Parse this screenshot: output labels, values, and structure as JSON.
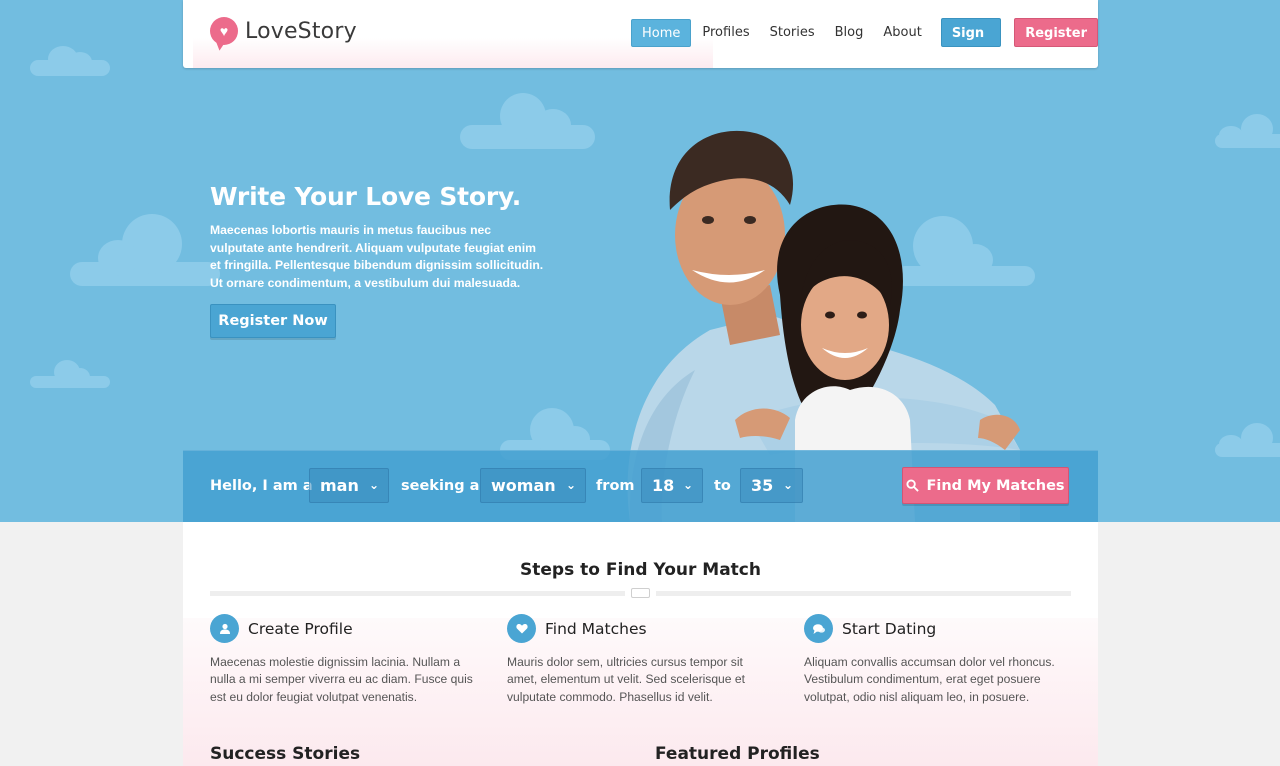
{
  "brand": {
    "name": "LoveStory"
  },
  "nav": {
    "items": [
      {
        "label": "Home",
        "active": true
      },
      {
        "label": "Profiles",
        "active": false
      },
      {
        "label": "Stories",
        "active": false
      },
      {
        "label": "Blog",
        "active": false
      },
      {
        "label": "About",
        "active": false
      }
    ],
    "sign_in": "Sign In",
    "register": "Register"
  },
  "hero": {
    "title": "Write Your Love Story.",
    "description": "Maecenas lobortis mauris in metus faucibus nec vulputate ante hendrerit. Aliquam vulputate feugiat enim et fringilla. Pellentesque bibendum dignissim sollicitudin. Ut ornare condimentum, a vestibulum dui malesuada.",
    "cta": "Register Now"
  },
  "search": {
    "hello_label": "Hello, I am a",
    "gender_value": "man",
    "seeking_label": "seeking a",
    "seeking_value": "woman",
    "from_label": "from",
    "age_from": "18",
    "to_label": "to",
    "age_to": "35",
    "submit": "Find My Matches"
  },
  "steps": {
    "title": "Steps to Find Your Match",
    "items": [
      {
        "icon": "user-icon",
        "title": "Create Profile",
        "text": "Maecenas molestie dignissim lacinia. Nullam a nulla a mi semper viverra eu ac diam. Fusce quis est eu dolor feugiat volutpat venenatis."
      },
      {
        "icon": "heart-icon",
        "title": "Find Matches",
        "text": "Mauris dolor sem, ultricies cursus tempor sit amet, elementum ut velit. Sed scelerisque et vulputate commodo. Phasellus id velit."
      },
      {
        "icon": "chat-icon",
        "title": "Start Dating",
        "text": "Aliquam convallis accumsan dolor vel rhoncus. Vestibulum condimentum, erat eget posuere volutpat, odio nisl aliquam leo, in posuere."
      }
    ]
  },
  "sections": {
    "success_stories": "Success Stories",
    "featured_profiles": "Featured Profiles"
  },
  "colors": {
    "sky": "#72bde0",
    "accent_blue": "#4aa5d3",
    "accent_pink": "#ec6b8b"
  }
}
